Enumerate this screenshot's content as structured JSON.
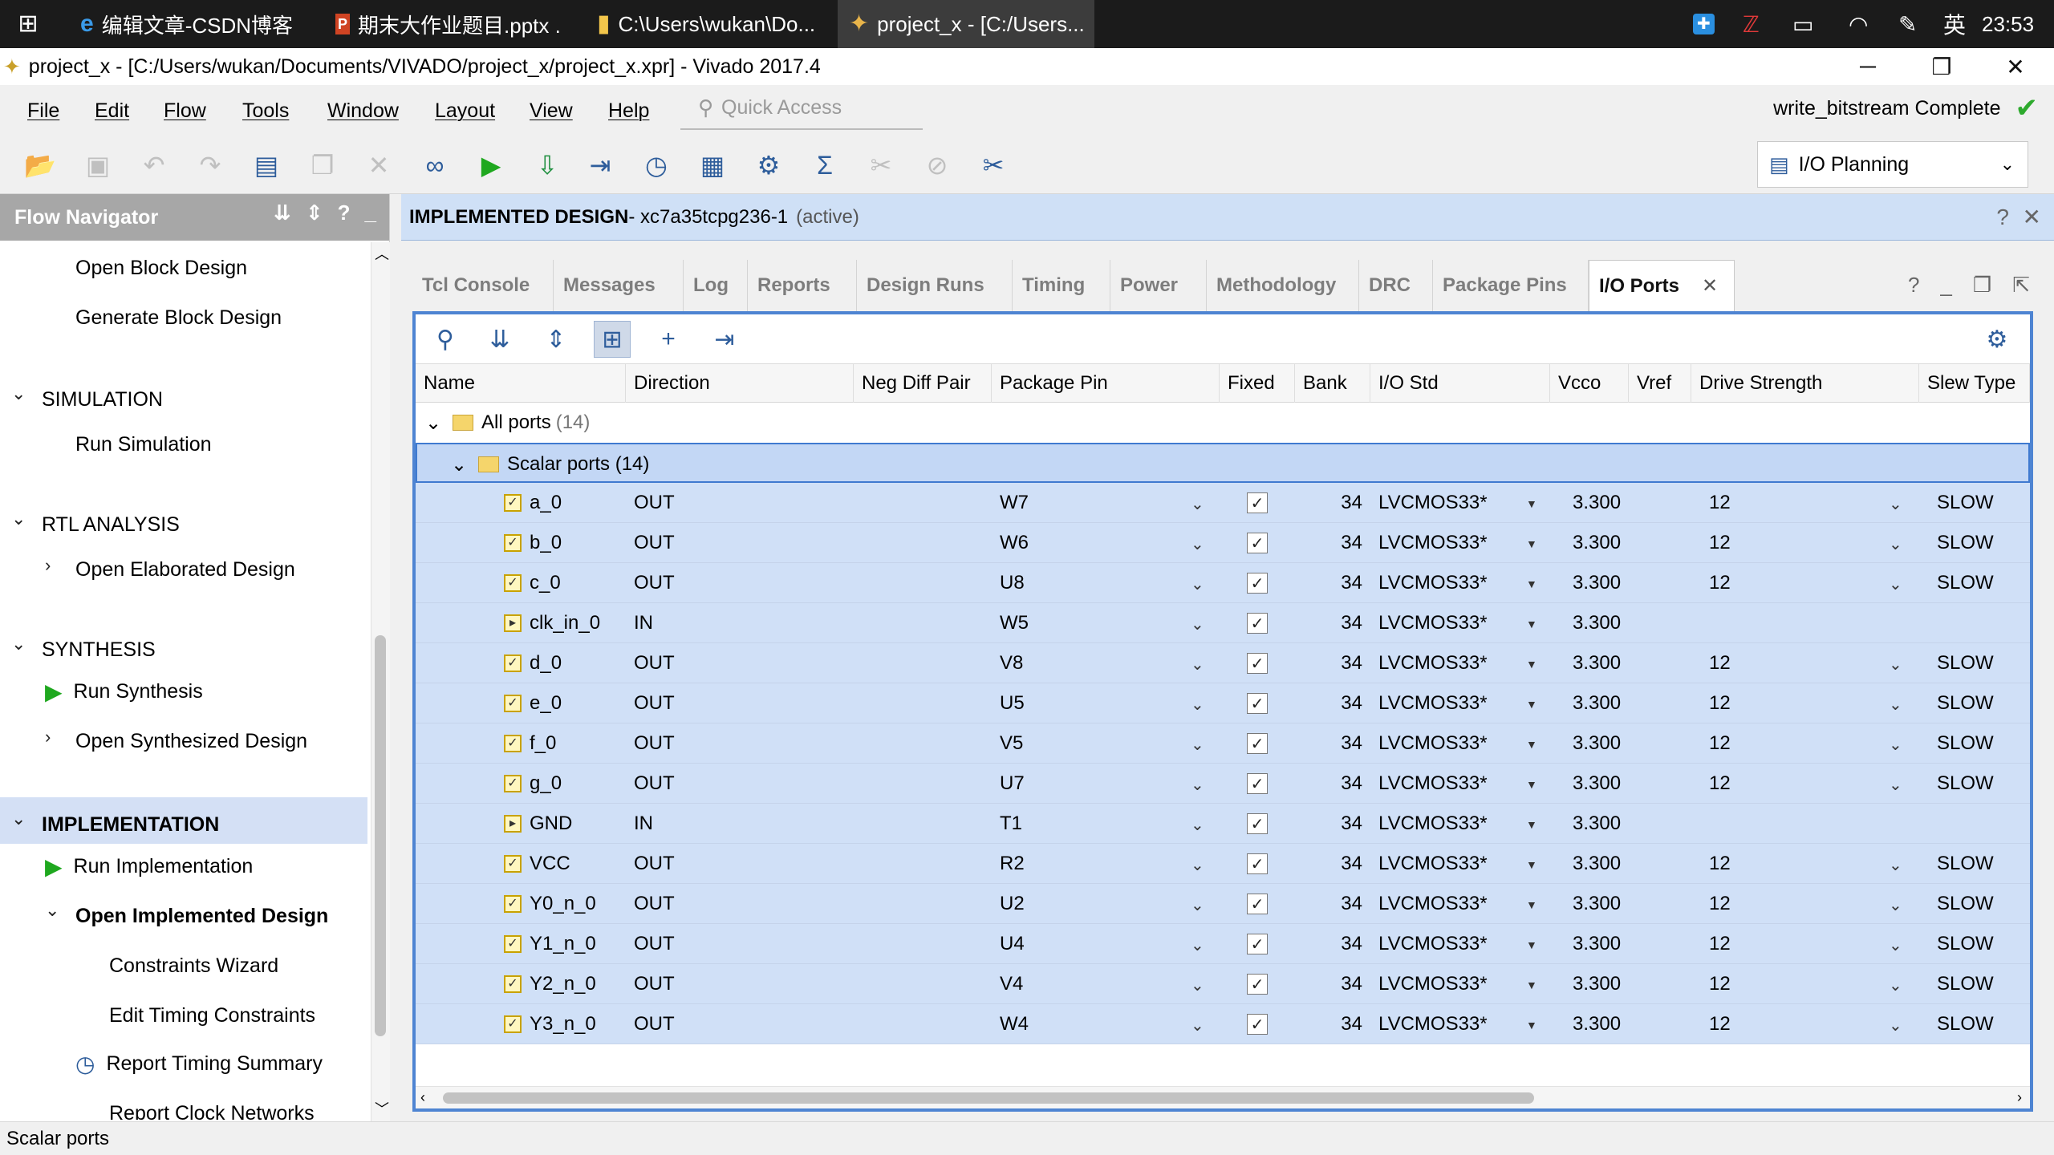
{
  "taskbar": {
    "items": [
      {
        "icon": "edge-icon",
        "label": "编辑文章-CSDN博客 ..."
      },
      {
        "icon": "powerpoint-icon",
        "label": "期末大作业题目.pptx ..."
      },
      {
        "icon": "folder-icon",
        "label": "C:\\Users\\wukan\\Do..."
      },
      {
        "icon": "vivado-icon",
        "label": "project_x - [C:/Users..."
      }
    ],
    "ime": "英",
    "clock": "23:53"
  },
  "window": {
    "title": "project_x - [C:/Users/wukan/Documents/VIVADO/project_x/project_x.xpr] - Vivado 2017.4",
    "minimize": "─",
    "maximize": "❐",
    "close": "✕"
  },
  "menu": {
    "items": [
      "File",
      "Edit",
      "Flow",
      "Tools",
      "Window",
      "Layout",
      "View",
      "Help"
    ],
    "quick_access_placeholder": "Quick Access",
    "status": "write_bitstream Complete"
  },
  "toolbar": {
    "layout_select": "I/O Planning"
  },
  "flow_navigator": {
    "title": "Flow Navigator",
    "open_block_design": "Open Block Design",
    "generate_block_design": "Generate Block Design",
    "simulation": "SIMULATION",
    "run_simulation": "Run Simulation",
    "rtl_analysis": "RTL ANALYSIS",
    "open_elaborated_design": "Open Elaborated Design",
    "synthesis": "SYNTHESIS",
    "run_synthesis": "Run Synthesis",
    "open_synthesized_design": "Open Synthesized Design",
    "implementation": "IMPLEMENTATION",
    "run_implementation": "Run Implementation",
    "open_implemented_design": "Open Implemented Design",
    "constraints_wizard": "Constraints Wizard",
    "edit_timing_constraints": "Edit Timing Constraints",
    "report_timing_summary": "Report Timing Summary",
    "report_clock_networks": "Report Clock Networks"
  },
  "design_header": {
    "title": "IMPLEMENTED DESIGN",
    "part": " - xc7a35tcpg236-1",
    "state": "(active)"
  },
  "tabs": [
    "Tcl Console",
    "Messages",
    "Log",
    "Reports",
    "Design Runs",
    "Timing",
    "Power",
    "Methodology",
    "DRC",
    "Package Pins",
    "I/O Ports"
  ],
  "io_ports": {
    "columns": [
      "Name",
      "Direction",
      "Neg Diff Pair",
      "Package Pin",
      "Fixed",
      "Bank",
      "I/O Std",
      "Vcco",
      "Vref",
      "Drive Strength",
      "Slew Type"
    ],
    "all_ports": "All ports",
    "all_ports_count": "(14)",
    "scalar_ports": "Scalar ports (14)",
    "rows": [
      {
        "name": "a_0",
        "dir": "OUT",
        "pin": "W7",
        "bank": "34",
        "std": "LVCMOS33*",
        "vcco": "3.300",
        "drive": "12",
        "slew": "SLOW"
      },
      {
        "name": "b_0",
        "dir": "OUT",
        "pin": "W6",
        "bank": "34",
        "std": "LVCMOS33*",
        "vcco": "3.300",
        "drive": "12",
        "slew": "SLOW"
      },
      {
        "name": "c_0",
        "dir": "OUT",
        "pin": "U8",
        "bank": "34",
        "std": "LVCMOS33*",
        "vcco": "3.300",
        "drive": "12",
        "slew": "SLOW"
      },
      {
        "name": "clk_in_0",
        "dir": "IN",
        "pin": "W5",
        "bank": "34",
        "std": "LVCMOS33*",
        "vcco": "3.300",
        "drive": "",
        "slew": ""
      },
      {
        "name": "d_0",
        "dir": "OUT",
        "pin": "V8",
        "bank": "34",
        "std": "LVCMOS33*",
        "vcco": "3.300",
        "drive": "12",
        "slew": "SLOW"
      },
      {
        "name": "e_0",
        "dir": "OUT",
        "pin": "U5",
        "bank": "34",
        "std": "LVCMOS33*",
        "vcco": "3.300",
        "drive": "12",
        "slew": "SLOW"
      },
      {
        "name": "f_0",
        "dir": "OUT",
        "pin": "V5",
        "bank": "34",
        "std": "LVCMOS33*",
        "vcco": "3.300",
        "drive": "12",
        "slew": "SLOW"
      },
      {
        "name": "g_0",
        "dir": "OUT",
        "pin": "U7",
        "bank": "34",
        "std": "LVCMOS33*",
        "vcco": "3.300",
        "drive": "12",
        "slew": "SLOW"
      },
      {
        "name": "GND",
        "dir": "IN",
        "pin": "T1",
        "bank": "34",
        "std": "LVCMOS33*",
        "vcco": "3.300",
        "drive": "",
        "slew": ""
      },
      {
        "name": "VCC",
        "dir": "OUT",
        "pin": "R2",
        "bank": "34",
        "std": "LVCMOS33*",
        "vcco": "3.300",
        "drive": "12",
        "slew": "SLOW"
      },
      {
        "name": "Y0_n_0",
        "dir": "OUT",
        "pin": "U2",
        "bank": "34",
        "std": "LVCMOS33*",
        "vcco": "3.300",
        "drive": "12",
        "slew": "SLOW"
      },
      {
        "name": "Y1_n_0",
        "dir": "OUT",
        "pin": "U4",
        "bank": "34",
        "std": "LVCMOS33*",
        "vcco": "3.300",
        "drive": "12",
        "slew": "SLOW"
      },
      {
        "name": "Y2_n_0",
        "dir": "OUT",
        "pin": "V4",
        "bank": "34",
        "std": "LVCMOS33*",
        "vcco": "3.300",
        "drive": "12",
        "slew": "SLOW"
      },
      {
        "name": "Y3_n_0",
        "dir": "OUT",
        "pin": "W4",
        "bank": "34",
        "std": "LVCMOS33*",
        "vcco": "3.300",
        "drive": "12",
        "slew": "SLOW"
      }
    ]
  },
  "statusbar": {
    "text": "Scalar ports"
  },
  "colors": {
    "accent": "#4e84d2",
    "selection": "#d0e0f7",
    "run_green": "#1fa81f",
    "header_blue": "#cfe0f6"
  }
}
